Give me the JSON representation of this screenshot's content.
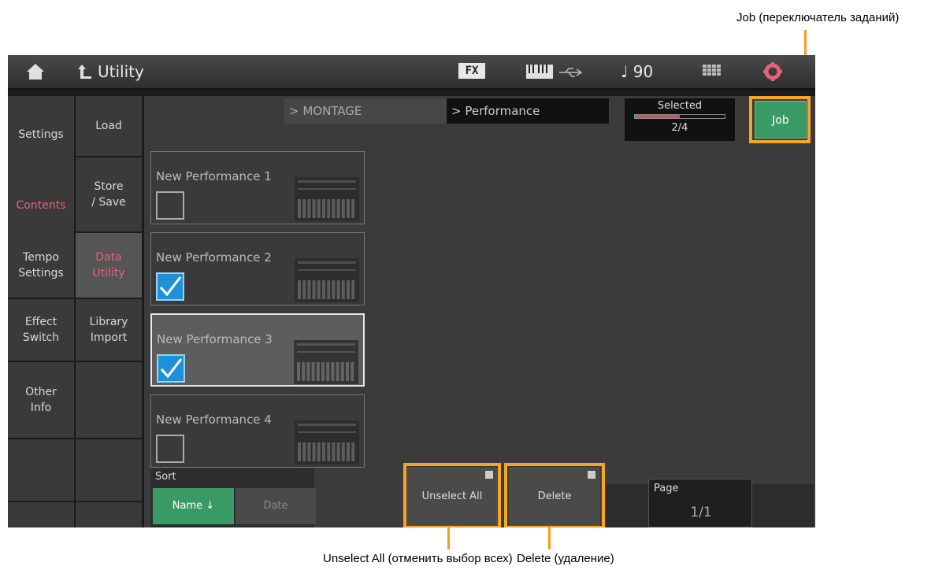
{
  "topbar": {
    "title": "Utility",
    "fx_label": "FX",
    "tempo": "♩ 90"
  },
  "sidebar_left": [
    {
      "label": "Settings"
    },
    {
      "label": "Contents",
      "active": true
    },
    {
      "label": "Tempo\nSettings"
    },
    {
      "label": "Effect\nSwitch"
    },
    {
      "label": "Other\nInfo"
    },
    {
      "label": ""
    }
  ],
  "sidebar_right": [
    {
      "label": "Load"
    },
    {
      "label": "Store\n/ Save"
    },
    {
      "label": "Data\nUtility",
      "active": true
    },
    {
      "label": "Library\nImport"
    },
    {
      "label": ""
    },
    {
      "label": ""
    }
  ],
  "breadcrumb": {
    "level1": "> MONTAGE",
    "level2": "> Performance"
  },
  "selected": {
    "label": "Selected",
    "count": "2/4",
    "fraction": 0.5
  },
  "job_button": "Job",
  "performances": [
    {
      "name": "New Performance 1",
      "checked": false,
      "focused": false
    },
    {
      "name": "New Performance 2",
      "checked": true,
      "focused": false
    },
    {
      "name": "New Performance 3",
      "checked": true,
      "focused": true
    },
    {
      "name": "New Performance 4",
      "checked": false,
      "focused": false
    }
  ],
  "sort": {
    "label": "Sort",
    "name_button": "Name ↓",
    "date_button": "Date"
  },
  "unselect_all_button": "Unselect All",
  "delete_button": "Delete",
  "page": {
    "label": "Page",
    "value": "1/1"
  },
  "callouts": {
    "job": "Job (переключатель заданий)",
    "unselect_all": "Unselect All (отменить выбор всех)",
    "delete": "Delete (удаление)"
  },
  "colors": {
    "accent_green": "#3a9a66",
    "active_pink": "#e8607a",
    "checkbox_blue": "#1e90d8",
    "highlight_orange": "#f5a623"
  }
}
